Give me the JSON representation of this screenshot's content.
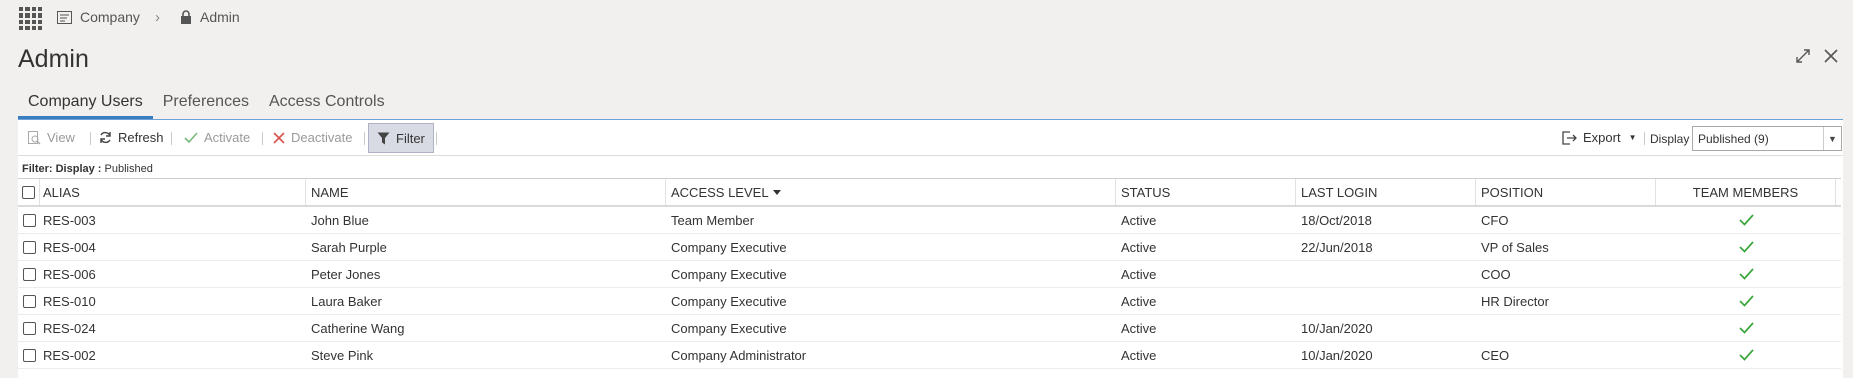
{
  "breadcrumb": [
    {
      "label": "Company",
      "icon": "document-icon"
    },
    {
      "label": "Admin",
      "icon": "lock-icon"
    }
  ],
  "page": {
    "title": "Admin"
  },
  "tabs": [
    {
      "label": "Company Users",
      "active": true
    },
    {
      "label": "Preferences",
      "active": false
    },
    {
      "label": "Access Controls",
      "active": false
    }
  ],
  "toolbar": {
    "view_label": "View",
    "refresh_label": "Refresh",
    "activate_label": "Activate",
    "deactivate_label": "Deactivate",
    "filter_label": "Filter",
    "export_label": "Export",
    "display_label": "Display",
    "display_value": "Published (9)"
  },
  "filter_status": {
    "prefix": "Filter: Display :",
    "value": "Published"
  },
  "table": {
    "columns": {
      "alias": "ALIAS",
      "name": "NAME",
      "access": "ACCESS LEVEL",
      "status": "STATUS",
      "login": "LAST LOGIN",
      "position": "POSITION",
      "team": "TEAM MEMBERS"
    },
    "rows": [
      {
        "alias": "RES-003",
        "name": "John Blue",
        "access": "Team Member",
        "status": "Active",
        "login": "18/Oct/2018",
        "position": "CFO",
        "team": true
      },
      {
        "alias": "RES-004",
        "name": "Sarah Purple",
        "access": "Company Executive",
        "status": "Active",
        "login": "22/Jun/2018",
        "position": "VP of Sales",
        "team": true
      },
      {
        "alias": "RES-006",
        "name": "Peter Jones",
        "access": "Company Executive",
        "status": "Active",
        "login": "",
        "position": "COO",
        "team": true
      },
      {
        "alias": "RES-010",
        "name": "Laura Baker",
        "access": "Company Executive",
        "status": "Active",
        "login": "",
        "position": "HR Director",
        "team": true
      },
      {
        "alias": "RES-024",
        "name": "Catherine Wang",
        "access": "Company Executive",
        "status": "Active",
        "login": "10/Jan/2020",
        "position": "",
        "team": true
      },
      {
        "alias": "RES-002",
        "name": "Steve Pink",
        "access": "Company Administrator",
        "status": "Active",
        "login": "10/Jan/2020",
        "position": "CEO",
        "team": true
      }
    ]
  },
  "colors": {
    "accent": "#3a7cc0",
    "check": "#3aa53a",
    "deactivate": "#d9534f"
  }
}
